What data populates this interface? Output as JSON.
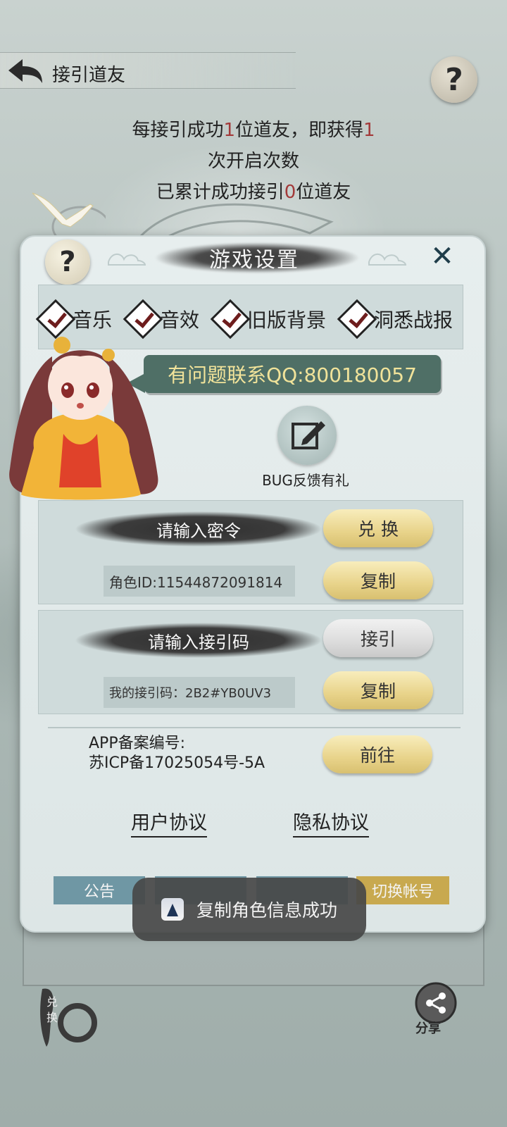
{
  "header": {
    "title": "接引道友"
  },
  "invite_info": {
    "line1_prefix": "每接引成功",
    "line1_count": "1",
    "line1_mid": "位道友，即获得",
    "line1_reward": "1",
    "line2": "次开启次数",
    "line3_prefix": "已累计成功接引",
    "line3_count": "0",
    "line3_suffix": "位道友"
  },
  "dialog": {
    "title": "游戏设置",
    "options": [
      {
        "label": "音乐",
        "checked": true
      },
      {
        "label": "音效",
        "checked": true
      },
      {
        "label": "旧版背景",
        "checked": true
      },
      {
        "label": "洞悉战报",
        "checked": true
      }
    ],
    "qq_contact": "有问题联系QQ:800180057",
    "bug_feedback_label": "BUG反馈有礼",
    "redeem": {
      "placeholder": "请输入密令",
      "button": "兑 换",
      "role_id": "角色ID:11544872091814",
      "copy_button": "复制"
    },
    "invite_code": {
      "placeholder": "请输入接引码",
      "button": "接引",
      "my_code": "我的接引码：2B2#YB0UV3",
      "copy_button": "复制"
    },
    "icp": {
      "line1": "APP备案编号:",
      "line2": "苏ICP备17025054号-5A",
      "button": "前往"
    },
    "links": {
      "user_agreement": "用户协议",
      "privacy_policy": "隐私协议"
    },
    "tabs": {
      "notice": "公告",
      "switch_account": "切换帐号"
    }
  },
  "toast": {
    "message": "复制角色信息成功"
  },
  "side": {
    "exchange": "兑换",
    "share": "分享"
  },
  "colors": {
    "accent_gold": "#e8d38a",
    "qq_text": "#f1e39a",
    "highlight_red": "#a33a3a"
  }
}
